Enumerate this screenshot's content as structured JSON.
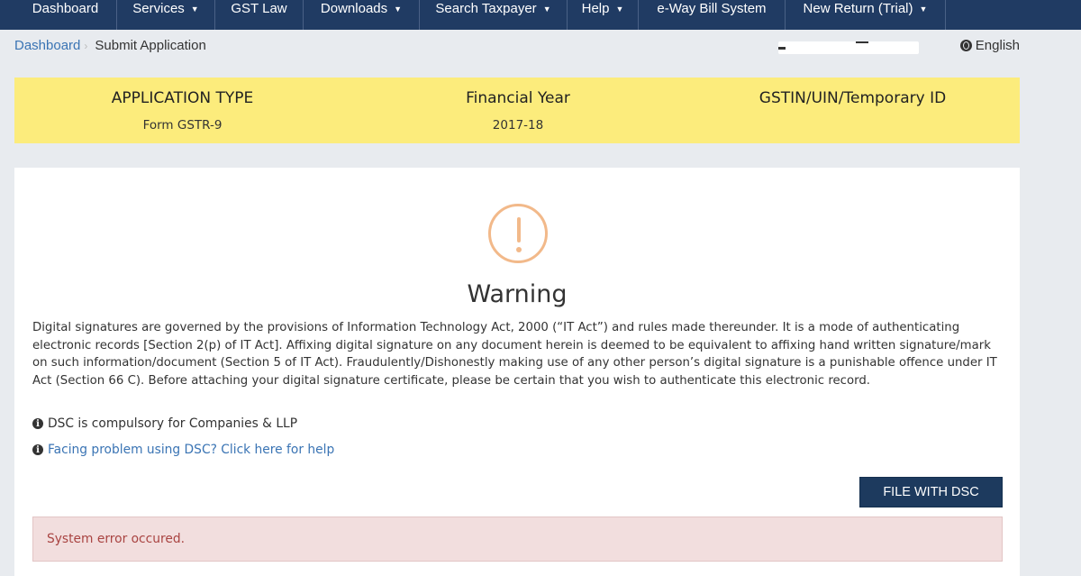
{
  "nav": {
    "items": [
      {
        "label": "Dashboard",
        "dropdown": false
      },
      {
        "label": "Services",
        "dropdown": true
      },
      {
        "label": "GST Law",
        "dropdown": false
      },
      {
        "label": "Downloads",
        "dropdown": true
      },
      {
        "label": "Search Taxpayer",
        "dropdown": true
      },
      {
        "label": "Help",
        "dropdown": true
      },
      {
        "label": "e-Way Bill System",
        "dropdown": false
      },
      {
        "label": "New Return (Trial)",
        "dropdown": true
      }
    ]
  },
  "breadcrumb": {
    "home": "Dashboard",
    "separator": "›",
    "current": "Submit Application"
  },
  "language": "English",
  "info_band": {
    "application_type_label": "APPLICATION TYPE",
    "application_type_value": "Form GSTR-9",
    "financial_year_label": "Financial Year",
    "financial_year_value": "2017-18",
    "gstin_label": "GSTIN/UIN/Temporary ID"
  },
  "warning": {
    "title": "Warning",
    "body": "Digital signatures are governed by the provisions of Information Technology Act, 2000 (“IT Act”) and rules made thereunder. It is a mode of authenticating electronic records [Section 2(p) of IT Act]. Affixing digital signature on any document herein is deemed to be equivalent to affixing hand written signature/mark on such information/document (Section 5 of IT Act). Fraudulently/Dishonestly making use of any other person’s digital signature is a punishable offence under IT Act (Section 66 C). Before attaching your digital signature certificate, please be certain that you wish to authenticate this electronic record.",
    "note_dsc": "DSC is compulsory for Companies & LLP",
    "help_link": "Facing problem using DSC? Click here for help"
  },
  "actions": {
    "file_with_dsc": "FILE WITH DSC"
  },
  "error_message": "System error occured.",
  "colors": {
    "nav_bg": "#203b63",
    "band_bg": "#fcec7c",
    "warning_icon": "#f2b98a",
    "button_bg": "#1d3a5e",
    "alert_bg": "#f2dede",
    "alert_text": "#a94442",
    "link": "#3a74b4"
  }
}
